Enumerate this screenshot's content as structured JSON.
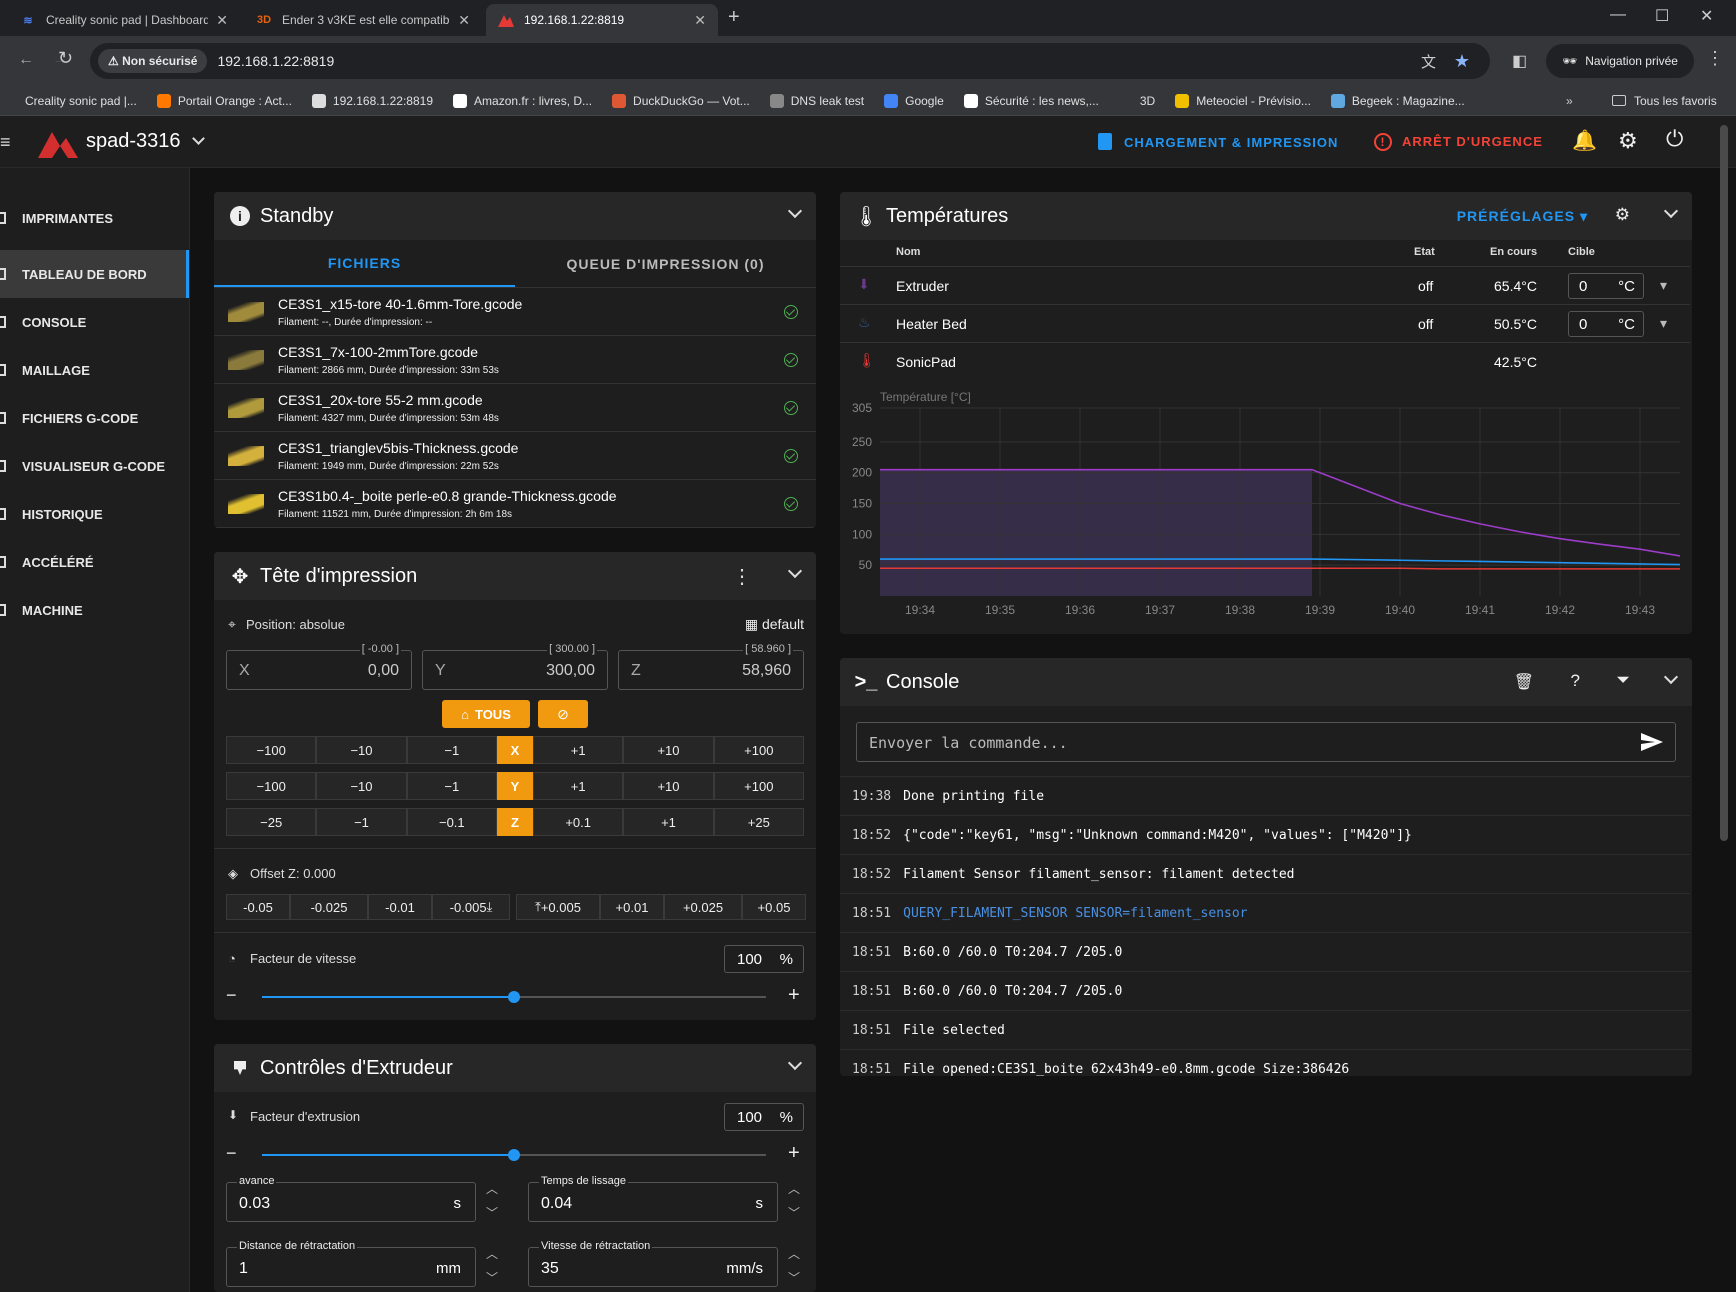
{
  "browser": {
    "tabs": [
      {
        "title": "Creality sonic pad | Dashboard",
        "icon": "layers-icon",
        "active": false
      },
      {
        "title": "Ender 3 v3KE est elle compatibl",
        "icon": "3d-logo-icon",
        "active": false
      },
      {
        "title": "192.168.1.22:8819",
        "icon": "mainsail-logo-icon",
        "active": true
      }
    ],
    "security_label": "Non sécurisé",
    "url": "192.168.1.22:8819",
    "incognito_label": "Navigation privée",
    "bookmarks": [
      {
        "label": "Creality sonic pad |...",
        "color": "#35363a"
      },
      {
        "label": "Portail Orange : Act...",
        "color": "#ff7900"
      },
      {
        "label": "192.168.1.22:8819",
        "color": "#dddddd"
      },
      {
        "label": "Amazon.fr : livres, D...",
        "color": "#ffffff"
      },
      {
        "label": "DuckDuckGo — Vot...",
        "color": "#de5833"
      },
      {
        "label": "DNS leak test",
        "color": "#888888"
      },
      {
        "label": "Google",
        "color": "#4285f4"
      },
      {
        "label": "Sécurité : les news,...",
        "color": "#ffffff"
      },
      {
        "label": "3D",
        "color": "#35363a"
      },
      {
        "label": "Meteociel - Prévisio...",
        "color": "#f0c000"
      },
      {
        "label": "Begeek : Magazine...",
        "color": "#5fa8e0"
      }
    ],
    "all_bookmarks_label": "Tous les favoris"
  },
  "app": {
    "printer_name": "spad-3316",
    "upload_print_label": "CHARGEMENT & IMPRESSION",
    "emergency_label": "ARRÊT D'URGENCE",
    "accent_color": "#2196f3",
    "danger_color": "#f44336"
  },
  "sidebar": {
    "items": [
      {
        "label": "IMPRIMANTES"
      },
      {
        "label": "TABLEAU DE BORD"
      },
      {
        "label": "CONSOLE"
      },
      {
        "label": "MAILLAGE"
      },
      {
        "label": "FICHIERS G-CODE"
      },
      {
        "label": "VISUALISEUR G-CODE"
      },
      {
        "label": "HISTORIQUE"
      },
      {
        "label": "ACCÉLÉRÉ"
      },
      {
        "label": "MACHINE"
      }
    ]
  },
  "status_panel": {
    "title": "Standby",
    "tabs": [
      "FICHIERS",
      "QUEUE D'IMPRESSION (0)"
    ],
    "files": [
      {
        "name": "CE3S1_x15-tore 40-1.6mm-Tore.gcode",
        "meta": "Filament: --, Durée d'impression: --"
      },
      {
        "name": "CE3S1_7x-100-2mmTore.gcode",
        "meta": "Filament: 2866 mm, Durée d'impression: 33m 53s"
      },
      {
        "name": "CE3S1_20x-tore 55-2 mm.gcode",
        "meta": "Filament: 4327 mm, Durée d'impression: 53m 48s"
      },
      {
        "name": "CE3S1_trianglev5bis-Thickness.gcode",
        "meta": "Filament: 1949 mm, Durée d'impression: 22m 52s"
      },
      {
        "name": "CE3S1b0.4-_boite perle-e0.8 grande-Thickness.gcode",
        "meta": "Filament: 11521 mm, Durée d'impression: 2h 6m 18s"
      }
    ]
  },
  "toolhead": {
    "title": "Tête d'impression",
    "position_label": "Position: absolue",
    "macro_label": "default",
    "x": {
      "label": "X",
      "value": "0,00",
      "limit": "[ -0.00 ]"
    },
    "y": {
      "label": "Y",
      "value": "300,00",
      "limit": "[ 300.00 ]"
    },
    "z": {
      "label": "Z",
      "value": "58,960",
      "limit": "[ 58.960 ]"
    },
    "home_all_label": "TOUS",
    "jog_x": [
      "−100",
      "−10",
      "−1",
      "X",
      "+1",
      "+10",
      "+100"
    ],
    "jog_y": [
      "−100",
      "−10",
      "−1",
      "Y",
      "+1",
      "+10",
      "+100"
    ],
    "jog_z": [
      "−25",
      "−1",
      "−0.1",
      "Z",
      "+0.1",
      "+1",
      "+25"
    ],
    "offset_label": "Offset Z: 0.000",
    "offset_buttons": [
      "-0.05",
      "-0.025",
      "-0.01",
      "-0.005",
      "+0.005",
      "+0.01",
      "+0.025",
      "+0.05"
    ],
    "speed_label": "Facteur de vitesse",
    "speed_value": "100",
    "speed_unit": "%",
    "speed_fraction": 0.5
  },
  "extruder_panel": {
    "title": "Contrôles d'Extrudeur",
    "factor_label": "Facteur d'extrusion",
    "factor_value": "100",
    "factor_unit": "%",
    "factor_fraction": 0.5,
    "advance": {
      "label": "avance",
      "value": "0.03",
      "unit": "s"
    },
    "smooth": {
      "label": "Temps de lissage",
      "value": "0.04",
      "unit": "s"
    },
    "retract_dist": {
      "label": "Distance de rétractation",
      "value": "1",
      "unit": "mm"
    },
    "retract_speed": {
      "label": "Vitesse de rétractation",
      "value": "35",
      "unit": "mm/s"
    }
  },
  "temps": {
    "title": "Températures",
    "presets_label": "PRÉRÉGLAGES",
    "headers": {
      "name": "Nom",
      "state": "Etat",
      "current": "En cours",
      "target": "Cible"
    },
    "rows": [
      {
        "name": "Extruder",
        "state": "off",
        "current": "65.4°C",
        "target": "0",
        "unit": "°C",
        "icon": "extruder-icon"
      },
      {
        "name": "Heater Bed",
        "state": "off",
        "current": "50.5°C",
        "target": "0",
        "unit": "°C",
        "icon": "heater-bed-icon"
      },
      {
        "name": "SonicPad",
        "state": "",
        "current": "42.5°C",
        "target": "",
        "unit": "",
        "icon": "thermometer-icon"
      }
    ]
  },
  "chart_data": {
    "type": "line",
    "title": "",
    "ylabel": "Température [°C]",
    "xlabel": "",
    "ylim": [
      0,
      305
    ],
    "y_ticks": [
      50,
      100,
      150,
      200,
      250,
      305
    ],
    "x_ticks": [
      "19:34",
      "19:35",
      "19:36",
      "19:37",
      "19:38",
      "19:39",
      "19:40",
      "19:41",
      "19:42",
      "19:43"
    ],
    "x": [
      "19:33.5",
      "19:38.9",
      "19:39.5",
      "19:40",
      "19:40.5",
      "19:41",
      "19:41.5",
      "19:42",
      "19:42.5",
      "19:43",
      "19:43.5"
    ],
    "series": [
      {
        "name": "",
        "color": "#9c3cc8",
        "values": [
          205,
          205,
          175,
          150,
          132,
          117,
          104,
          93,
          84,
          76,
          65
        ]
      },
      {
        "name": "",
        "color": "#2196f3",
        "values": [
          60,
          60,
          59,
          58,
          57,
          56,
          55,
          54,
          53,
          52,
          51
        ]
      },
      {
        "name": "",
        "color": "#e53935",
        "values": [
          45,
          45,
          45,
          45,
          44,
          44,
          44,
          44,
          44,
          44,
          44
        ]
      }
    ],
    "target_area": {
      "from": "19:33.5",
      "to": "19:38.9",
      "value": 205,
      "color": "#4b3a6b"
    },
    "grid": true
  },
  "console": {
    "title": "Console",
    "placeholder": "Envoyer la commande...",
    "lines": [
      {
        "time": "19:38",
        "text": "Done printing file",
        "type": "response"
      },
      {
        "time": "18:52",
        "text": "{\"code\":\"key61, \"msg\":\"Unknown command:M420\", \"values\": [\"M420\"]}",
        "type": "response"
      },
      {
        "time": "18:52",
        "text": "Filament Sensor filament_sensor: filament detected",
        "type": "response"
      },
      {
        "time": "18:51",
        "text": "QUERY_FILAMENT_SENSOR SENSOR=filament_sensor",
        "type": "command"
      },
      {
        "time": "18:51",
        "text": "B:60.0 /60.0 T0:204.7 /205.0",
        "type": "response"
      },
      {
        "time": "18:51",
        "text": "B:60.0 /60.0 T0:204.7 /205.0",
        "type": "response"
      },
      {
        "time": "18:51",
        "text": "File selected",
        "type": "response"
      },
      {
        "time": "18:51",
        "text": "File opened:CE3S1_boite 62x43h49-e0.8mm.gcode Size:386426",
        "type": "response"
      }
    ]
  }
}
